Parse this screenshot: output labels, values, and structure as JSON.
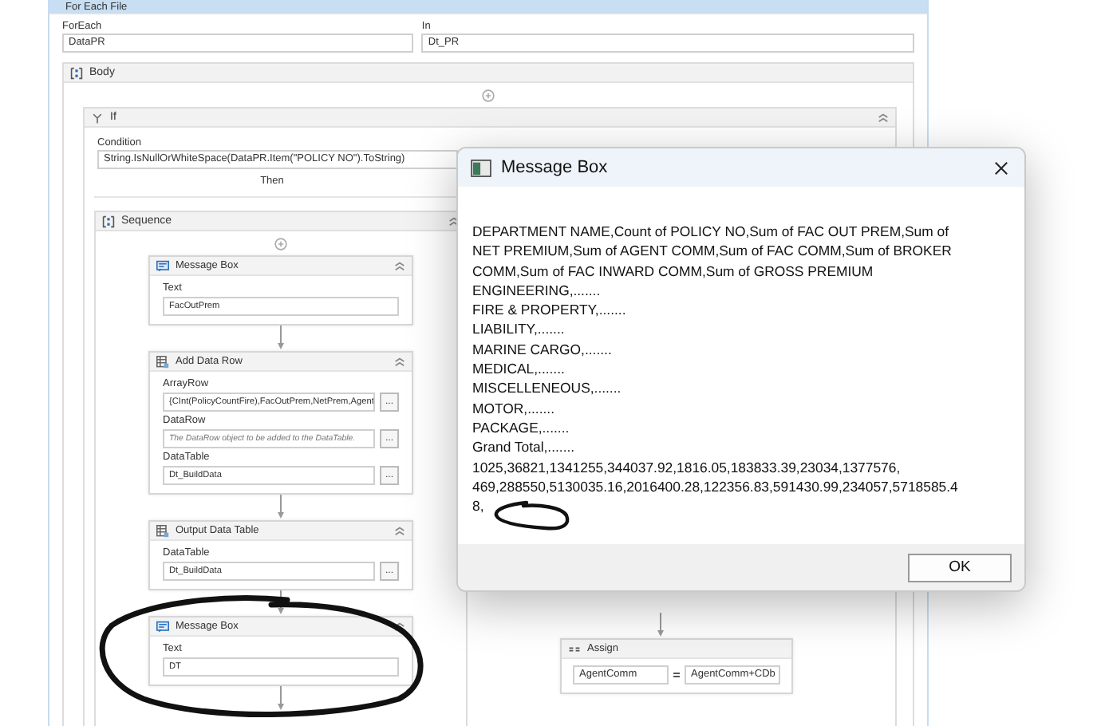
{
  "workflow": {
    "title": "For Each File",
    "arguments": [
      {
        "label": "ForEach",
        "value": "DataPR"
      },
      {
        "label": "In",
        "value": "Dt_PR"
      }
    ],
    "body": {
      "title": "Body",
      "if": {
        "title": "If",
        "condition_label": "Condition",
        "condition": "String.IsNullOrWhiteSpace(DataPR.Item(\"POLICY NO\").ToString)",
        "then_label": "Then",
        "sequence": {
          "title": "Sequence",
          "activities": [
            {
              "kind": "message",
              "title": "Message Box",
              "fields": [
                {
                  "label": "Text",
                  "value": "FacOutPrem"
                }
              ]
            },
            {
              "kind": "datarow",
              "title": "Add Data Row",
              "fields": [
                {
                  "label": "ArrayRow",
                  "value": "{CInt(PolicyCountFire),FacOutPrem,NetPrem,Agent",
                  "button": "..."
                },
                {
                  "label": "DataRow",
                  "placeholder": "The DataRow object to be added to the DataTable.",
                  "button": "..."
                },
                {
                  "label": "DataTable",
                  "value": "Dt_BuildData",
                  "button": "..."
                }
              ]
            },
            {
              "kind": "output",
              "title": "Output Data Table",
              "fields": [
                {
                  "label": "DataTable",
                  "value": "Dt_BuildData",
                  "button": "..."
                }
              ]
            },
            {
              "kind": "message",
              "title": "Message Box",
              "fields": [
                {
                  "label": "Text",
                  "value": "DT"
                }
              ]
            }
          ]
        },
        "else_activities": [
          {
            "kind": "assign",
            "title": "Assign",
            "target": "AgentComm",
            "expression": "AgentComm+CDb"
          }
        ]
      }
    }
  },
  "dialog": {
    "title": "Message Box",
    "lines": [
      "DEPARTMENT NAME,Count of POLICY NO,Sum of FAC OUT PREM,Sum of NET PREMIUM,Sum of AGENT COMM,Sum of FAC COMM,Sum of BROKER COMM,Sum of FAC INWARD COMM,Sum of GROSS PREMIUM",
      "ENGINEERING,.......",
      "FIRE & PROPERTY,.......",
      "LIABILITY,.......",
      "MARINE CARGO,.......",
      "MEDICAL,.......",
      "MISCELLENEOUS,.......",
      "MOTOR,.......",
      "PACKAGE,.......",
      "Grand Total,.......",
      "1025,36821,1341255,344037.92,1816.05,183833.39,23034,1377576,",
      "469,288550,5130035.16,2016400.28,122356.83,591430.99,234057,5718585.4",
      "8,"
    ],
    "button": "OK"
  }
}
